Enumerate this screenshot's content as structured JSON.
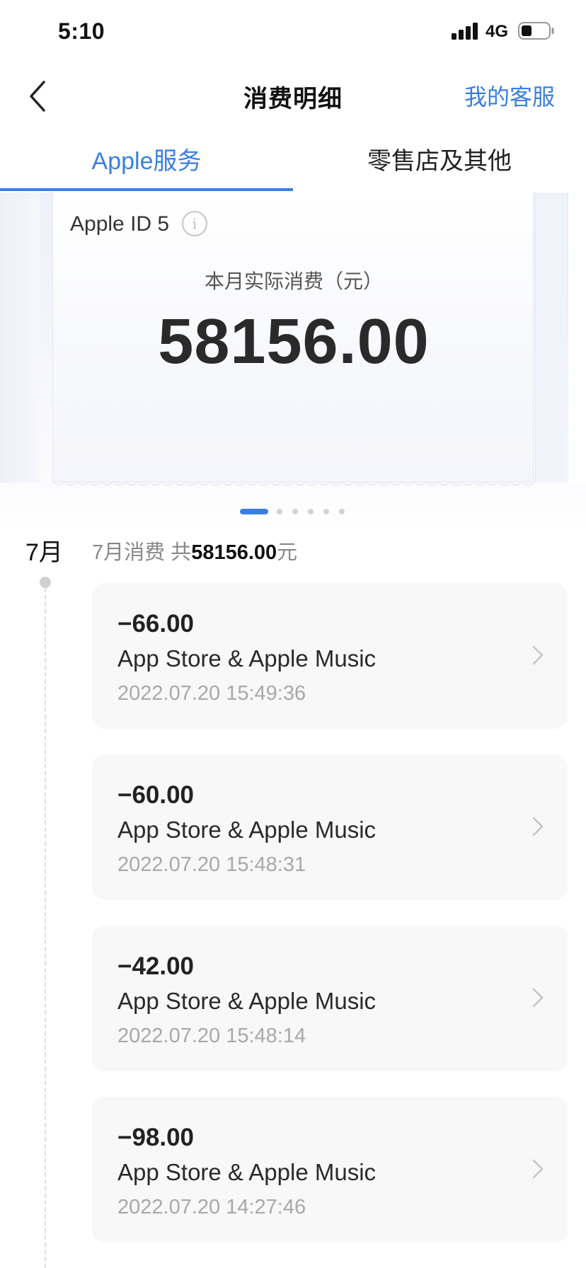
{
  "status_bar": {
    "time": "5:10",
    "network": "4G"
  },
  "nav": {
    "title": "消费明细",
    "right_link": "我的客服"
  },
  "tabs": [
    {
      "label": "Apple服务",
      "active": true
    },
    {
      "label": "零售店及其他",
      "active": false
    }
  ],
  "summary_card": {
    "account": "Apple ID 5",
    "month_label": "本月实际消费（元）",
    "amount": "58156.00"
  },
  "pager": {
    "count": 6,
    "active_index": 0
  },
  "month_section": {
    "month": "7月",
    "summary_prefix": "7月消费 共",
    "summary_total": "58156.00",
    "summary_unit": "元"
  },
  "transactions": [
    {
      "amount": "−66.00",
      "merchant": "App Store & Apple Music",
      "time": "2022.07.20 15:49:36"
    },
    {
      "amount": "−60.00",
      "merchant": "App Store & Apple Music",
      "time": "2022.07.20 15:48:31"
    },
    {
      "amount": "−42.00",
      "merchant": "App Store & Apple Music",
      "time": "2022.07.20 15:48:14"
    },
    {
      "amount": "−98.00",
      "merchant": "App Store & Apple Music",
      "time": "2022.07.20 14:27:46"
    }
  ],
  "colors": {
    "accent": "#3a7fe0",
    "text_primary": "#222222",
    "text_secondary": "#a8a8a8",
    "card_bg": "#f8f8f8"
  },
  "icons": {
    "back": "chevron-left-icon",
    "info": "info-icon",
    "row_arrow": "chevron-right-icon",
    "signal": "signal-icon",
    "battery": "battery-icon"
  }
}
